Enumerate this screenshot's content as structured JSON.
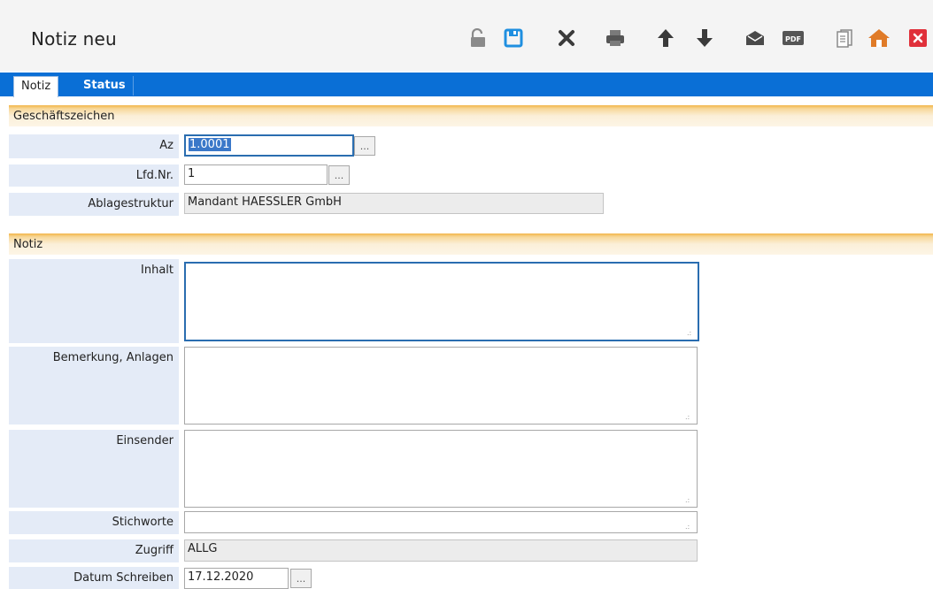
{
  "window": {
    "title": "Notiz  neu"
  },
  "toolbar": {
    "icons": [
      "unlock-icon",
      "save-icon",
      "delete-icon",
      "print-icon",
      "arrow-up-icon",
      "arrow-down-icon",
      "mail-icon",
      "pdf-icon",
      "document-icon",
      "home-icon",
      "close-icon"
    ],
    "pdf_text": "PDF"
  },
  "tabs": [
    {
      "label": "Notiz",
      "active": true
    },
    {
      "label": "Status",
      "active": false
    }
  ],
  "sections": {
    "geschaeftszeichen": "Geschäftszeichen",
    "notiz": "Notiz"
  },
  "fields": {
    "az": {
      "label": "Az",
      "value": "1.0001"
    },
    "lfdnr": {
      "label": "Lfd.Nr.",
      "value": "1"
    },
    "ablagestruktur": {
      "label": "Ablagestruktur",
      "value": "Mandant HAESSLER GmbH"
    },
    "inhalt": {
      "label": "Inhalt",
      "value": ""
    },
    "bemerkung": {
      "label": "Bemerkung, Anlagen",
      "value": ""
    },
    "einsender": {
      "label": "Einsender",
      "value": ""
    },
    "stichworte": {
      "label": "Stichworte",
      "value": ""
    },
    "zugriff": {
      "label": "Zugriff",
      "value": "ALLG"
    },
    "datum": {
      "label": "Datum Schreiben",
      "value": "17.12.2020"
    }
  },
  "lookup_button_label": "...",
  "colors": {
    "tabbar": "#0a6fd6",
    "label_bg": "#e4ebf7",
    "section_accent": "#f2b64a",
    "close": "#e0303a",
    "save": "#1f8fe0"
  }
}
